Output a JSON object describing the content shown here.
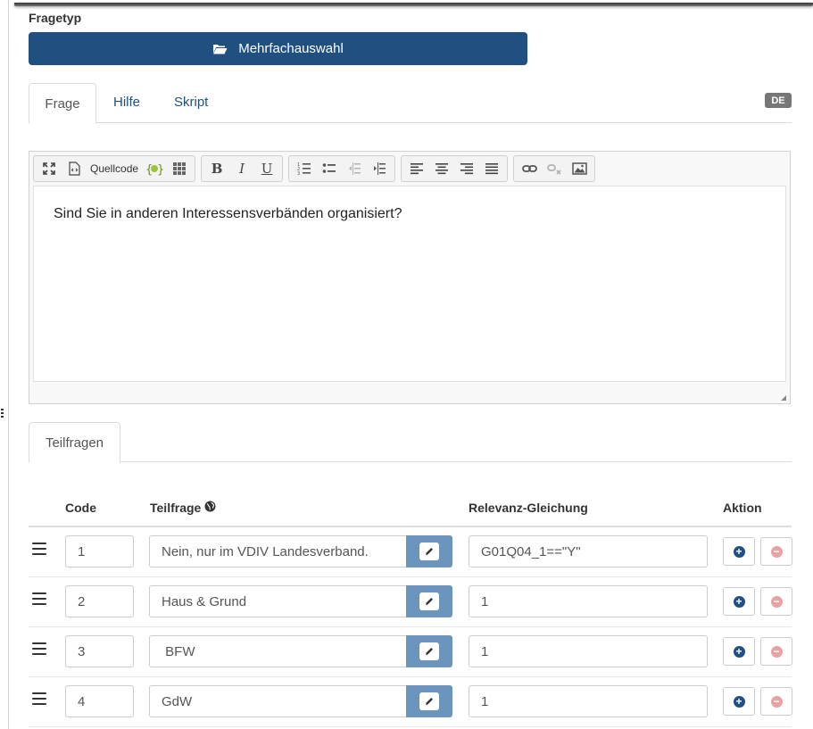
{
  "question_type": {
    "label": "Fragetyp",
    "value": "Mehrfachauswahl",
    "icon": "folder-open-icon"
  },
  "question_tabs": [
    {
      "label": "Frage",
      "active": true
    },
    {
      "label": "Hilfe",
      "active": false
    },
    {
      "label": "Skript",
      "active": false
    }
  ],
  "language_badge": "DE",
  "editor": {
    "toolbar": {
      "source_label": "Quellcode",
      "bold": "B",
      "italic": "I",
      "underline": "U"
    },
    "content": "Sind Sie in anderen Interessensverbänden organisiert?"
  },
  "subquestions_tab": "Teilfragen",
  "table": {
    "headers": {
      "code": "Code",
      "subquestion": "Teilfrage",
      "relevance": "Relevanz-Gleichung",
      "action": "Aktion"
    },
    "rows": [
      {
        "code": "1",
        "text": "Nein, nur im VDIV Landesverband.",
        "relevance": "G01Q04_1==\"Y\""
      },
      {
        "code": "2",
        "text": "Haus & Grund",
        "relevance": "1"
      },
      {
        "code": "3",
        "text": " BFW",
        "relevance": "1"
      },
      {
        "code": "4",
        "text": "GdW",
        "relevance": "1"
      }
    ]
  },
  "colors": {
    "primary": "#1f5080",
    "pencil_button": "#6b95bd",
    "remove_icon": "#e5a3a3",
    "badge": "#777777"
  }
}
